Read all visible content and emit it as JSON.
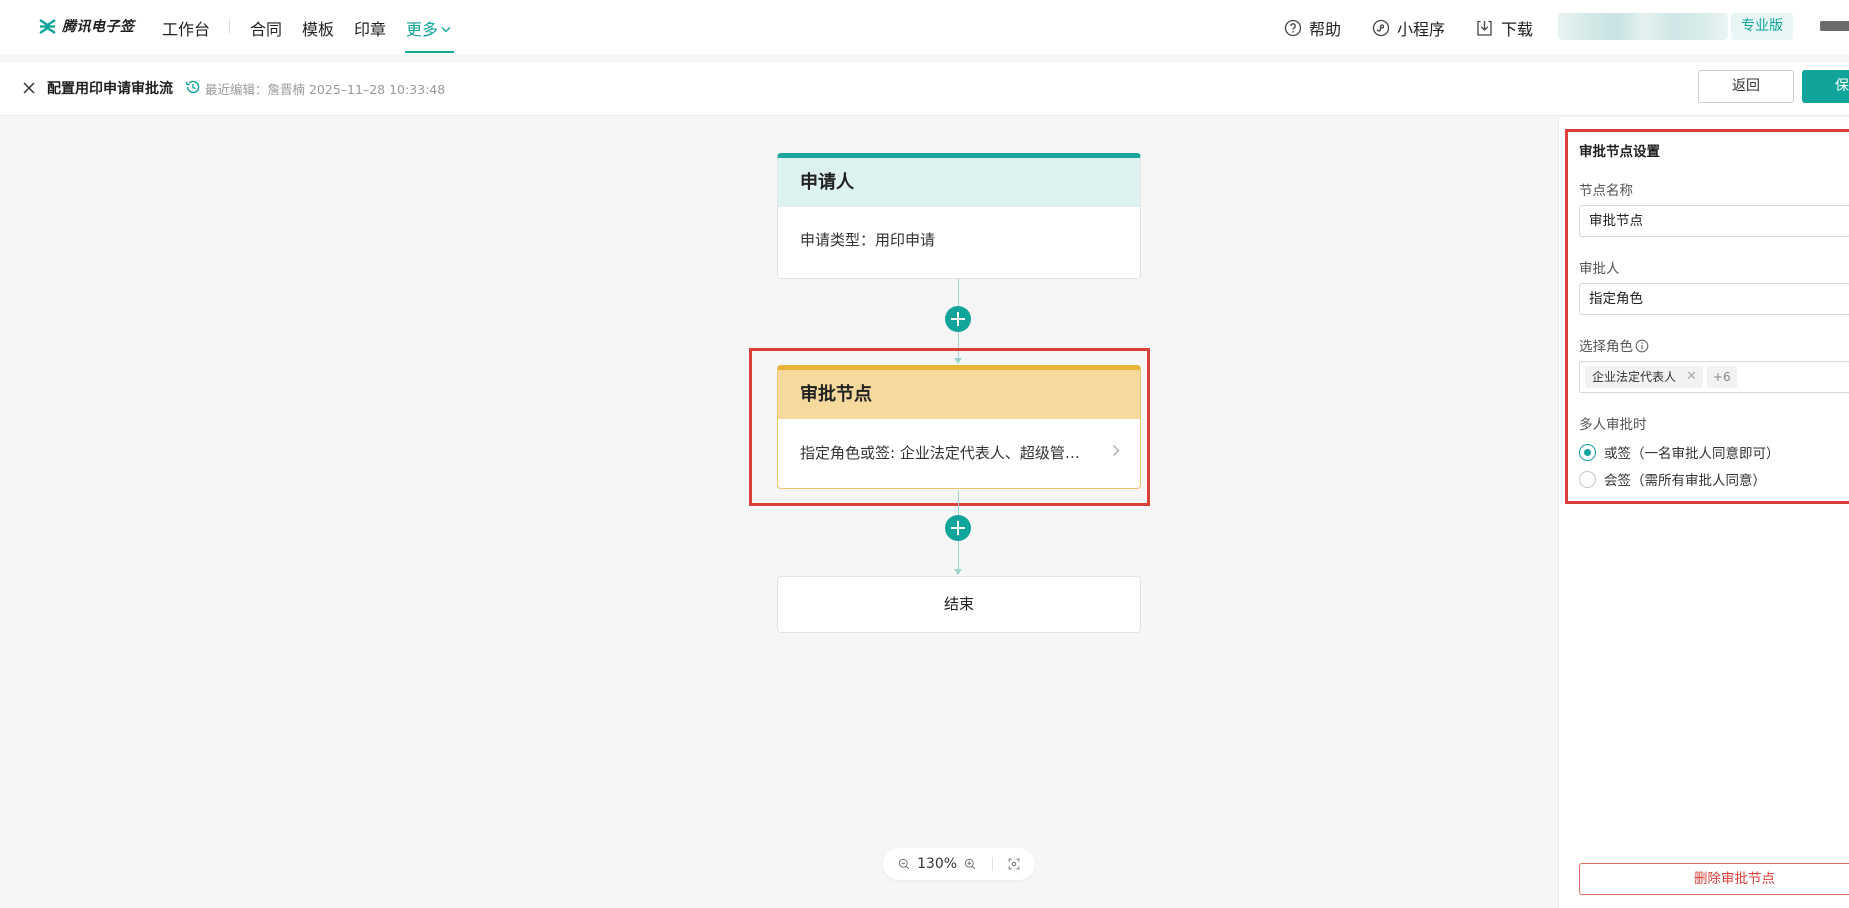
{
  "app": {
    "logo_text": "腾讯电子签",
    "nav": [
      "工作台",
      "合同",
      "模板",
      "印章",
      "更多"
    ],
    "help_label": "帮助",
    "miniprogram_label": "小程序",
    "download_label": "下载",
    "edition_label": "专业版",
    "brand_color": "#10a49a"
  },
  "header": {
    "title": "配置用印申请审批流",
    "last_edit": "最近编辑：詹晋楠 2025–11–28 10:33:48",
    "back_label": "返回",
    "save_label": "保"
  },
  "flow": {
    "applicant": {
      "title": "申请人",
      "body": "申请类型：用印申请"
    },
    "approval": {
      "title": "审批节点",
      "body": "指定角色或签: 企业法定代表人、超级管理员"
    },
    "end": {
      "title": "结束"
    },
    "zoom": "130%"
  },
  "panel": {
    "title": "审批节点设置",
    "node_name_label": "节点名称",
    "node_name_value": "审批节点",
    "approver_label": "审批人",
    "approver_value": "指定角色",
    "role_label": "选择角色",
    "role_tag": "企业法定代表人",
    "role_more": "+6",
    "multi_label": "多人审批时",
    "options": [
      "或签（一名审批人同意即可）",
      "会签（需所有审批人同意）"
    ],
    "selected_option": 0,
    "delete_label": "删除审批节点"
  }
}
